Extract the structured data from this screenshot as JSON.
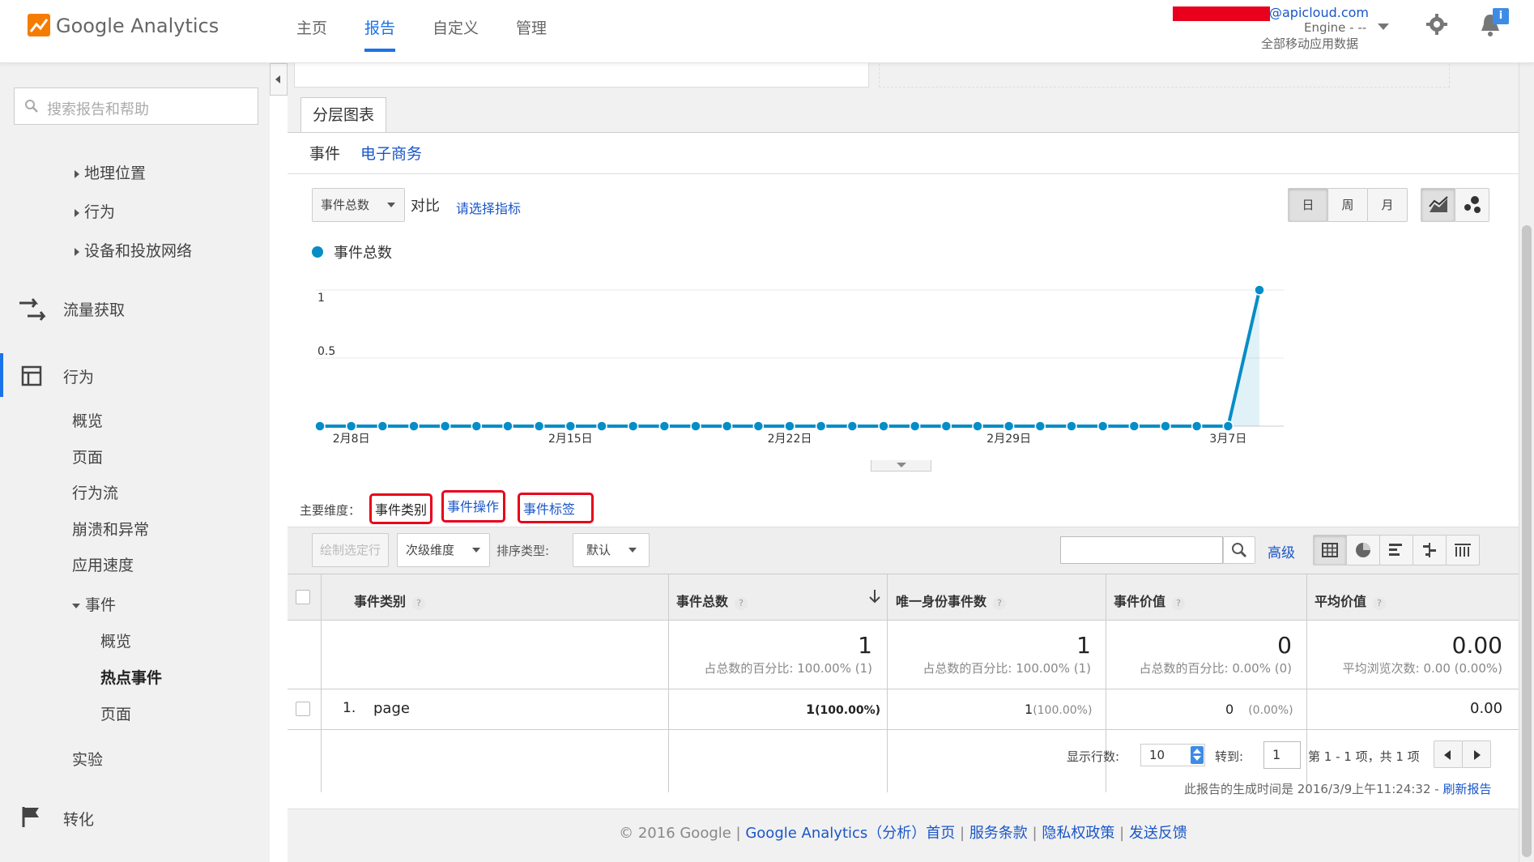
{
  "app": {
    "logo_text": "Google Analytics",
    "nav": [
      "主页",
      "报告",
      "自定义",
      "管理"
    ],
    "active_nav": "报告"
  },
  "account": {
    "email": "@apicloud.com",
    "property": "Engine - --",
    "view": "全部移动应用数据"
  },
  "sidebar": {
    "search_placeholder": "搜索报告和帮助",
    "geo": "地理位置",
    "behavior_sub": "行为",
    "devices": "设备和投放网络",
    "acquisition": "流量获取",
    "behavior": "行为",
    "overview": "概览",
    "pages": "页面",
    "flow": "行为流",
    "crashes": "崩溃和异常",
    "speed": "应用速度",
    "events": "事件",
    "events_overview": "概览",
    "top_events": "热点事件",
    "events_pages": "页面",
    "experiments": "实验",
    "conversions": "转化"
  },
  "report": {
    "tab": "分层图表",
    "subtab_events": "事件",
    "subtab_ecommerce": "电子商务",
    "metric_select": "事件总数",
    "compare_label": "对比",
    "choose_metric": "请选择指标",
    "period_day": "日",
    "period_week": "周",
    "period_month": "月",
    "legend": "事件总数",
    "primary_dim_label": "主要维度：",
    "dim_category": "事件类别",
    "dim_action": "事件操作",
    "dim_label": "事件标签",
    "plot_rows": "绘制选定行",
    "secondary_dim": "次级维度",
    "sort_type_label": "排序类型:",
    "sort_default": "默认",
    "advanced": "高级"
  },
  "chart_data": {
    "type": "line",
    "x": [
      "2月7日",
      "2月8日",
      "2月9日",
      "2月10日",
      "2月11日",
      "2月12日",
      "2月13日",
      "2月14日",
      "2月15日",
      "2月16日",
      "2月17日",
      "2月18日",
      "2月19日",
      "2月20日",
      "2月21日",
      "2月22日",
      "2月23日",
      "2月24日",
      "2月25日",
      "2月26日",
      "2月27日",
      "2月28日",
      "2月29日",
      "3月1日",
      "3月2日",
      "3月3日",
      "3月4日",
      "3月5日",
      "3月6日",
      "3月7日",
      "3月8日"
    ],
    "x_tick_labels": [
      "2月8日",
      "2月15日",
      "2月22日",
      "2月29日",
      "3月7日"
    ],
    "series": [
      {
        "name": "事件总数",
        "values": [
          0,
          0,
          0,
          0,
          0,
          0,
          0,
          0,
          0,
          0,
          0,
          0,
          0,
          0,
          0,
          0,
          0,
          0,
          0,
          0,
          0,
          0,
          0,
          0,
          0,
          0,
          0,
          0,
          0,
          0,
          1
        ]
      }
    ],
    "y_ticks": [
      "1",
      "0.5"
    ],
    "ylim": [
      0,
      1
    ],
    "color": "#058dc7"
  },
  "table": {
    "headers": [
      "事件类别",
      "事件总数",
      "唯一身份事件数",
      "事件价值",
      "平均价值"
    ],
    "totals": {
      "total_events": "1",
      "total_events_note": "占总数的百分比: 100.00% (1)",
      "unique_events": "1",
      "unique_events_note": "占总数的百分比: 100.00% (1)",
      "event_value": "0",
      "event_value_note": "占总数的百分比: 0.00% (0)",
      "avg_value": "0.00",
      "avg_value_note": "平均浏览次数: 0.00 (0.00%)"
    },
    "rows": [
      {
        "index": "1.",
        "category": "page",
        "total_events": "1",
        "total_events_pct": "(100.00%)",
        "unique_events": "1",
        "unique_events_pct": "(100.00%)",
        "event_value": "0",
        "event_value_pct": "(0.00%)",
        "avg_value": "0.00"
      }
    ]
  },
  "pagination": {
    "rows_label": "显示行数:",
    "rows_value": "10",
    "goto_label": "转到:",
    "goto_value": "1",
    "range_text": "第 1 - 1 项，共 1 项"
  },
  "generated": {
    "text": "此报告的生成时间是 2016/3/9上午11:24:32 - ",
    "refresh": "刷新报告"
  },
  "footer": {
    "copyright": "© 2016 Google | ",
    "ga_home": "Google Analytics（分析）首页",
    "terms": "服务条款",
    "privacy": "隐私权政策",
    "feedback": "发送反馈"
  },
  "colors": {
    "accent": "#1a73e8",
    "series": "#058dc7",
    "highlight": "#e8001c",
    "link": "#1a56c8"
  }
}
